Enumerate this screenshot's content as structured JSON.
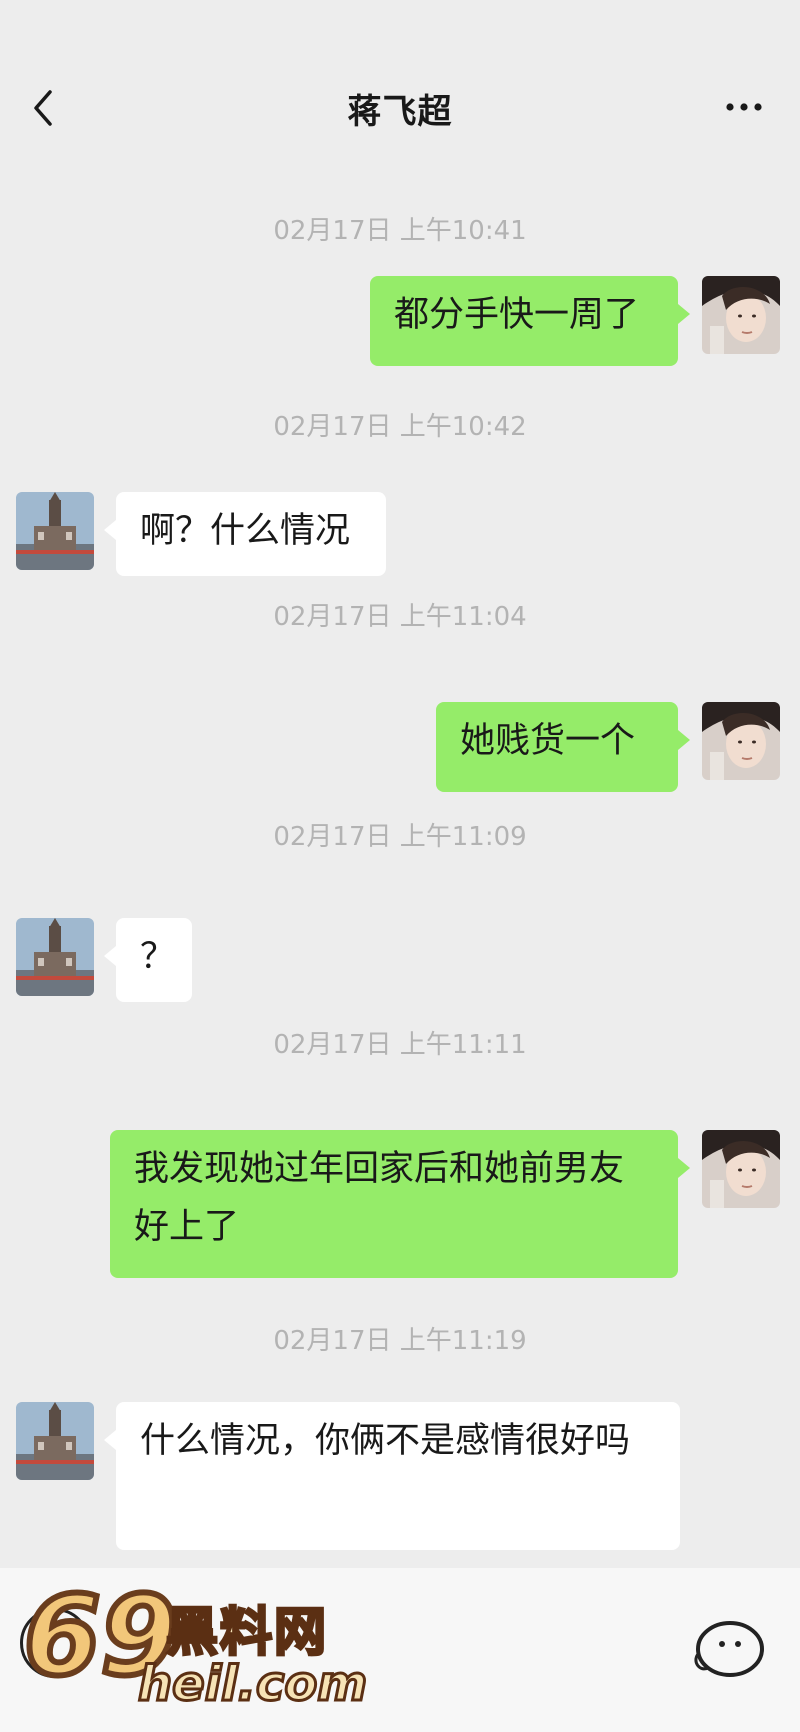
{
  "header": {
    "title": "蒋飞超",
    "back_icon": "chevron-left-icon",
    "more_icon": "more-dots-icon"
  },
  "messages": [
    {
      "timestamp": "02月17日 上午10:41",
      "sender": "self",
      "text": "都分手快一周了"
    },
    {
      "timestamp": "02月17日 上午10:42",
      "sender": "other",
      "text": "啊？什么情况"
    },
    {
      "timestamp": "02月17日 上午11:04",
      "sender": "self",
      "text": "她贱货一个"
    },
    {
      "timestamp": "02月17日 上午11:09",
      "sender": "other",
      "text": "？"
    },
    {
      "timestamp": "02月17日 上午11:11",
      "sender": "self",
      "text": "我发现她过年回家后和她前男友好上了"
    },
    {
      "timestamp": "02月17日 上午11:19",
      "sender": "other",
      "text": "什么情况，你俩不是感情很好吗"
    }
  ],
  "watermark": {
    "num": "69",
    "cn": "黑料网",
    "url": "heil.com"
  },
  "colors": {
    "background": "#ededed",
    "self_bubble": "#95ec69",
    "other_bubble": "#ffffff",
    "timestamp": "#b3b3b3"
  }
}
